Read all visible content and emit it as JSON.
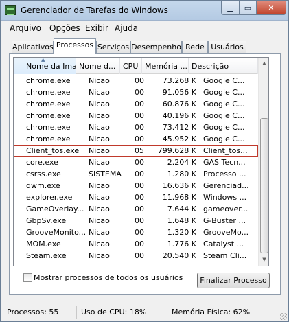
{
  "window": {
    "title": "Gerenciador de Tarefas do Windows"
  },
  "menu": [
    "Arquivo",
    "Opções",
    "Exibir",
    "Ajuda"
  ],
  "tabs": [
    "Aplicativos",
    "Processos",
    "Serviços",
    "Desempenho",
    "Rede",
    "Usuários"
  ],
  "active_tab": "Processos",
  "table": {
    "columns": [
      "Nome da Ima...",
      "Nome d...",
      "CPU",
      "Memória ...",
      "Descrição"
    ],
    "sorted_column": "Nome da Ima...",
    "rows": [
      [
        "chrome.exe",
        "Nicao",
        "00",
        "73.268 K",
        "Google C..."
      ],
      [
        "chrome.exe",
        "Nicao",
        "00",
        "91.056 K",
        "Google C..."
      ],
      [
        "chrome.exe",
        "Nicao",
        "00",
        "60.876 K",
        "Google C..."
      ],
      [
        "chrome.exe",
        "Nicao",
        "00",
        "40.196 K",
        "Google C..."
      ],
      [
        "chrome.exe",
        "Nicao",
        "00",
        "73.412 K",
        "Google C..."
      ],
      [
        "chrome.exe",
        "Nicao",
        "00",
        "45.952 K",
        "Google C..."
      ],
      [
        "Client_tos.exe",
        "Nicao",
        "05",
        "799.628 K",
        "Client_tos..."
      ],
      [
        "core.exe",
        "Nicao",
        "00",
        "2.204 K",
        "GAS Tecn..."
      ],
      [
        "csrss.exe",
        "SISTEMA",
        "00",
        "1.280 K",
        "Processo ..."
      ],
      [
        "dwm.exe",
        "Nicao",
        "00",
        "16.636 K",
        "Gerenciad..."
      ],
      [
        "explorer.exe",
        "Nicao",
        "00",
        "11.968 K",
        "Windows ..."
      ],
      [
        "GameOverlay...",
        "Nicao",
        "00",
        "7.644 K",
        "gameover..."
      ],
      [
        "GbpSv.exe",
        "Nicao",
        "00",
        "1.648 K",
        "G-Buster ..."
      ],
      [
        "GrooveMonito...",
        "Nicao",
        "00",
        "1.320 K",
        "GrooveMo..."
      ],
      [
        "MOM.exe",
        "Nicao",
        "00",
        "1.776 K",
        "Catalyst ..."
      ],
      [
        "Steam.exe",
        "Nicao",
        "00",
        "20.540 K",
        "Steam Cli..."
      ]
    ],
    "highlighted_row": "Client_tos.exe"
  },
  "show_all_processes": {
    "label": "Mostrar processos de todos os usuários",
    "checked": false
  },
  "end_process_button": "Finalizar Processo",
  "status": {
    "processes": "Processos: 55",
    "cpu": "Uso de CPU: 18%",
    "memory": "Memória Física: 62%"
  }
}
